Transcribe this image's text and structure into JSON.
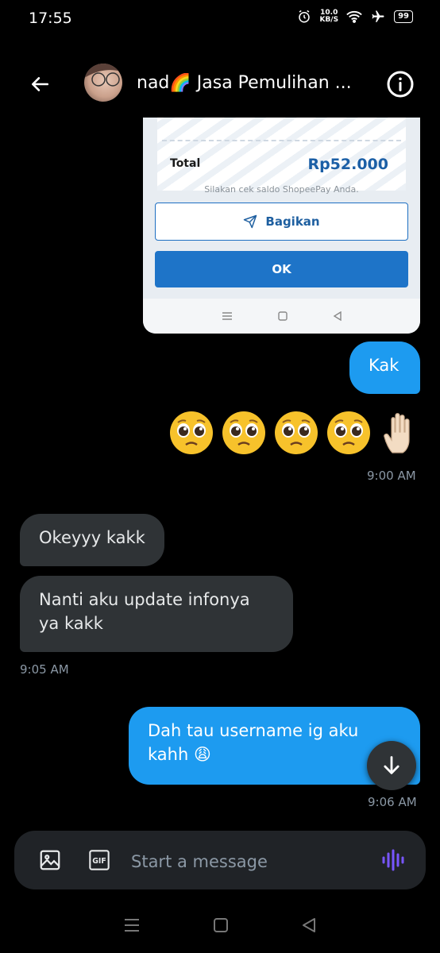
{
  "status_bar": {
    "time": "17:55",
    "net_speed": "10.0",
    "net_unit": "KB/S",
    "battery": "99"
  },
  "header": {
    "title": "nad🌈 Jasa Pemulihan ..."
  },
  "shared_screenshot": {
    "total_label": "Total",
    "total_value": "Rp52.000",
    "note": "Silakan cek saldo ShopeePay Anda.",
    "share_label": "Bagikan",
    "ok_label": "OK"
  },
  "messages": [
    {
      "side": "sent",
      "text": "Kak"
    },
    {
      "side": "sent",
      "text": "🥺🥺🥺🥺✋🏻",
      "time": "9:00 AM"
    },
    {
      "side": "received",
      "text": "Okeyyy kakk"
    },
    {
      "side": "received",
      "text": "Nanti aku update infonya ya kakk",
      "time": "9:05 AM"
    },
    {
      "side": "sent",
      "text": "Dah tau username ig aku kahh 😩",
      "time": "9:06 AM"
    }
  ],
  "composer": {
    "placeholder": "Start a message",
    "gif_label": "GIF"
  },
  "colors": {
    "accent": "#1d9bf0",
    "received_bubble": "#2f3336",
    "background": "#000000",
    "voice": "#7856ff"
  }
}
